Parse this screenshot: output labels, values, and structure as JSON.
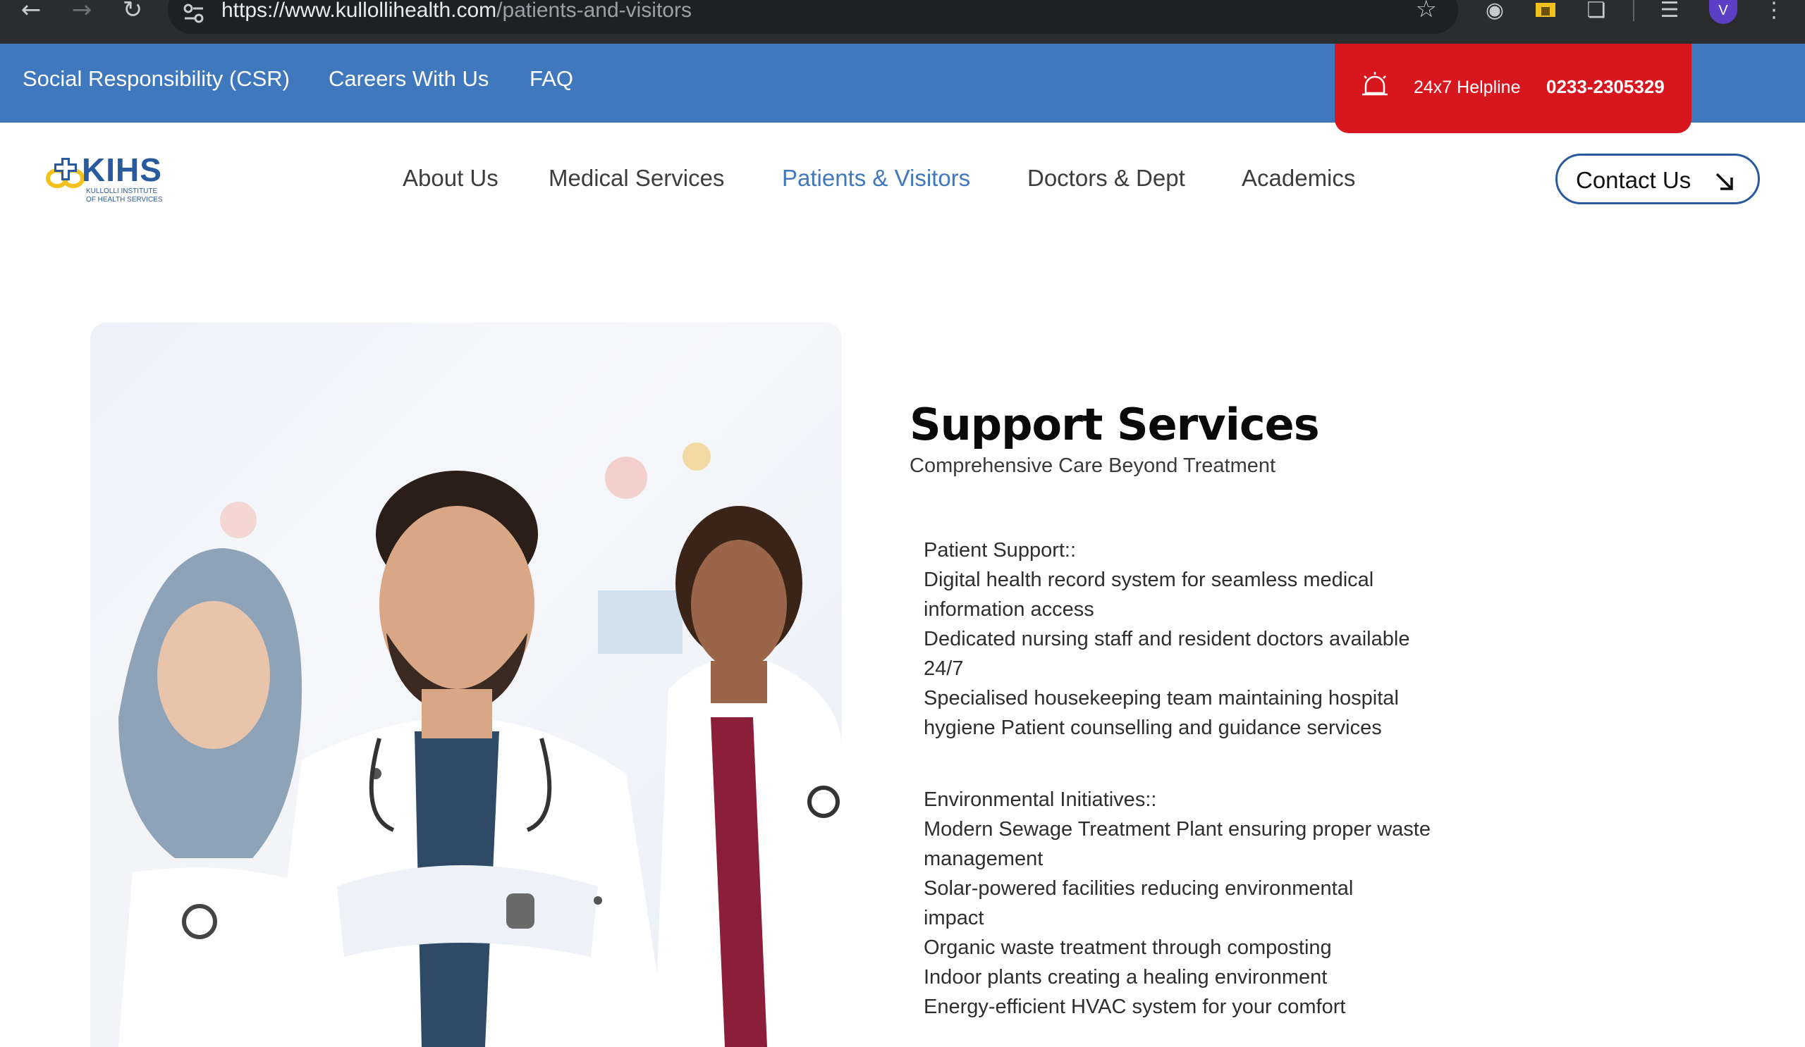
{
  "browser": {
    "url_host": "https://www.kullollihealth.com",
    "url_path": "/patients-and-visitors",
    "profile_initial": "V"
  },
  "topbar": {
    "links": [
      "Social Responsibility (CSR)",
      "Careers With Us",
      "FAQ"
    ],
    "helpline_label": "24x7 Helpline",
    "helpline_number": "0233-2305329"
  },
  "logo": {
    "wordmark": "KIHS",
    "subtitle_line1": "KULLOLLI INSTITUTE",
    "subtitle_line2": "OF HEALTH SERVICES"
  },
  "nav": {
    "items": [
      "About Us",
      "Medical Services",
      "Patients & Visitors",
      "Doctors & Dept",
      "Academics"
    ],
    "active": "Patients & Visitors",
    "contact_label": "Contact Us"
  },
  "content": {
    "title": "Support Services",
    "subtitle": "Comprehensive Care Beyond Treatment",
    "patient_support": {
      "heading": "Patient Support::",
      "lines": [
        "Digital health record system for seamless medical",
        "information access",
        "Dedicated nursing staff and resident doctors available",
        "24/7",
        "Specialised housekeeping team maintaining hospital",
        "hygiene Patient counselling and guidance services"
      ]
    },
    "environmental": {
      "heading": "Environmental Initiatives::",
      "lines": [
        "Modern Sewage Treatment Plant ensuring proper waste",
        "management",
        "Solar-powered facilities reducing environmental",
        "impact",
        "Organic waste treatment through composting",
        "Indoor plants creating a healing environment",
        "Energy-efficient HVAC system for your comfort"
      ]
    }
  },
  "colors": {
    "brand_blue": "#3f78bd",
    "helpline_red": "#d8161d",
    "logo_yellow": "#f2c11b"
  }
}
